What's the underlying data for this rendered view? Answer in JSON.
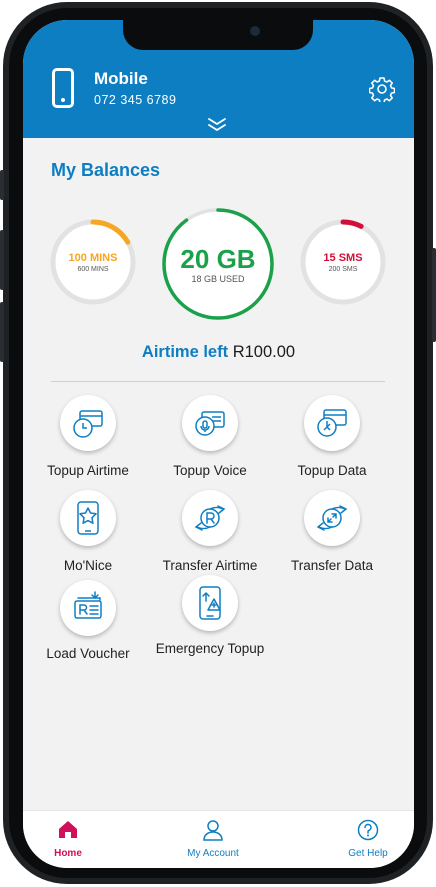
{
  "header": {
    "title": "Mobile",
    "number": "072 345 6789"
  },
  "balances": {
    "title": "My Balances",
    "mins": {
      "value": "100 MINS",
      "sub": "600 MINS",
      "used_fraction": 0.167,
      "color": "#f5a623"
    },
    "data": {
      "value": "20 GB",
      "sub": "18 GB USED",
      "used_fraction": 0.9,
      "color": "#1aa14a"
    },
    "sms": {
      "value": "15 SMS",
      "sub": "200 SMS",
      "used_fraction": 0.075,
      "color": "#d0103a"
    }
  },
  "airtime": {
    "label": "Airtime left",
    "value": "R100.00"
  },
  "actions": [
    {
      "label": "Topup Airtime",
      "icon": "topup-airtime-icon"
    },
    {
      "label": "Topup Voice",
      "icon": "topup-voice-icon"
    },
    {
      "label": "Topup Data",
      "icon": "topup-data-icon"
    },
    {
      "label": "Mo'Nice",
      "icon": "monice-icon"
    },
    {
      "label": "Transfer Airtime",
      "icon": "transfer-airtime-icon"
    },
    {
      "label": "Transfer Data",
      "icon": "transfer-data-icon"
    },
    {
      "label": "Load Voucher",
      "icon": "load-voucher-icon"
    },
    {
      "label": "Emergency Topup",
      "icon": "emergency-topup-icon"
    }
  ],
  "nav": {
    "home": "Home",
    "account": "My Account",
    "help": "Get Help"
  },
  "colors": {
    "brand_blue": "#0e7ec2",
    "active_pink": "#d0105a"
  }
}
